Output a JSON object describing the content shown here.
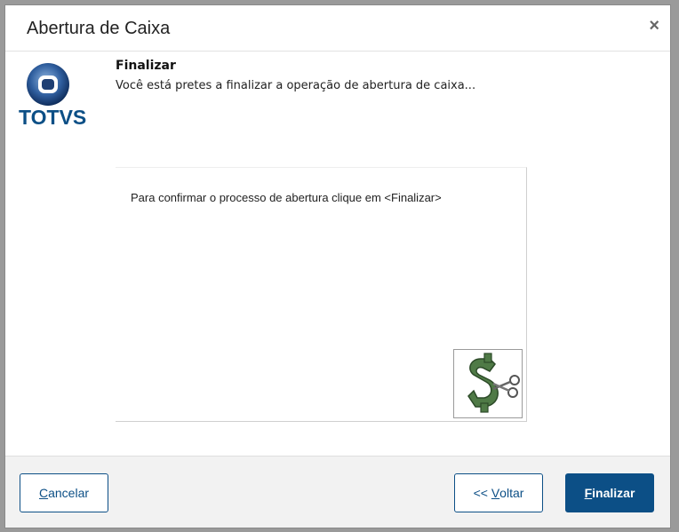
{
  "dialog": {
    "title": "Abertura de Caixa",
    "close_symbol": "×"
  },
  "logo": {
    "text": "TOTVS",
    "icon": "totvs-logo-icon"
  },
  "step": {
    "title": "Finalizar",
    "description": "Você está pretes a finalizar a operação de abertura de caixa..."
  },
  "panel": {
    "message": "Para confirmar o processo de abertura clique em <Finalizar>",
    "image_icon": "money-scissors-icon"
  },
  "footer": {
    "cancel": {
      "first": "C",
      "rest": "ancelar"
    },
    "back": {
      "prefix": "<< ",
      "first": "V",
      "rest": "oltar"
    },
    "finish": {
      "first": "F",
      "rest": "inalizar"
    }
  },
  "colors": {
    "accent": "#0c4f86",
    "footer_bg": "#f2f2f2",
    "overlay": "#9a9a9a"
  }
}
